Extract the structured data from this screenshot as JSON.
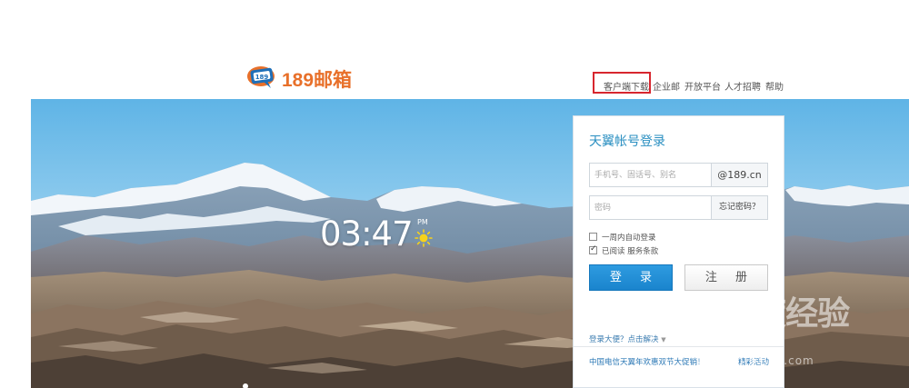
{
  "brand": {
    "logo_text": "189邮箱",
    "badge_text": "189",
    "accent": "#e8702a"
  },
  "topnav": {
    "items": [
      {
        "label": "客户端下载",
        "highlighted": true
      },
      {
        "label": "企业邮"
      },
      {
        "label": "开放平台"
      },
      {
        "label": "人才招聘"
      },
      {
        "label": "帮助"
      }
    ]
  },
  "hero": {
    "time": "03:47",
    "ampm": "PM",
    "weather_icon": "sun-icon"
  },
  "login": {
    "title": "天翼帐号登录",
    "account_placeholder": "手机号、固话号、别名",
    "account_suffix": "@189.cn",
    "password_placeholder": "密码",
    "forgot_password": "忘记密码？",
    "remember": {
      "label": "一周内自动登录",
      "checked": false
    },
    "terms": {
      "label": "已阅读 服务条款",
      "checked": true
    },
    "login_button": "登  录",
    "register_button": "注  册",
    "help_link": "登录大便？点击解决",
    "promo": "中国电信天翼年欢惠双节大促销！",
    "promo_right": "精彩活动",
    "accent": "#2a8fc1"
  },
  "watermark": {
    "text": "Bai度经验",
    "sub": "jingyan.baidu.com"
  }
}
